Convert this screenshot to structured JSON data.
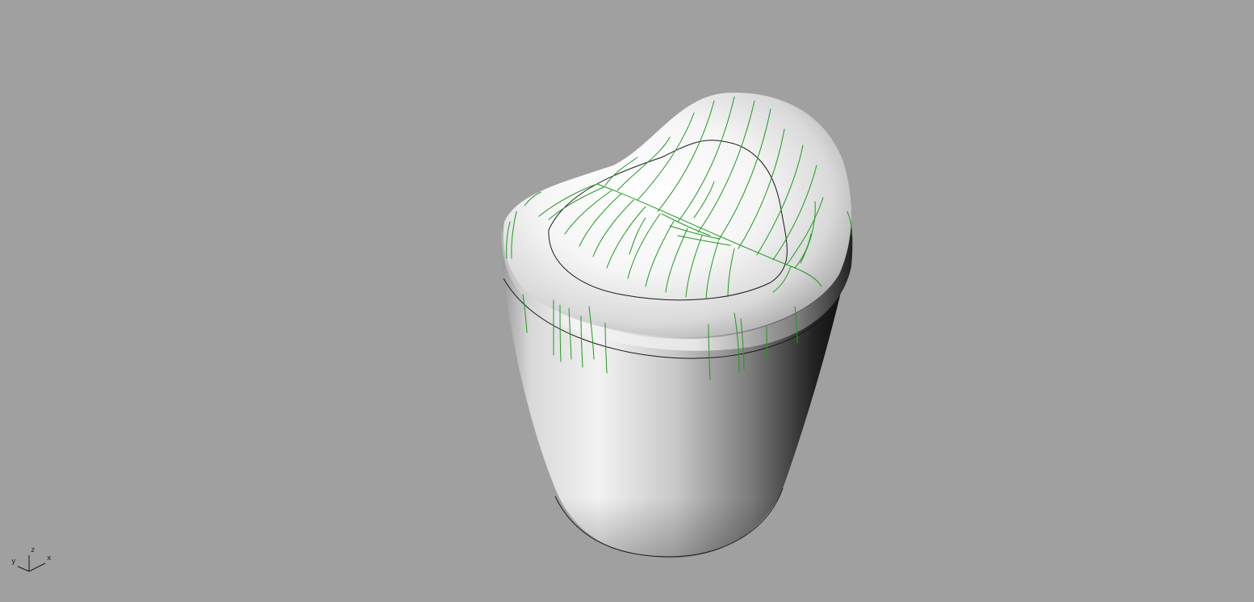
{
  "viewport": {
    "background_color": "#a0a0a0",
    "display_mode": "rendered-shaded",
    "model_color_light": "#ffffff",
    "model_color_dark": "#111111",
    "analysis_curve_color": "#1f9a1f",
    "edge_color": "#1a1a1a"
  },
  "axis_gizmo": {
    "y_label": "y",
    "z_label": "z",
    "x_label": "x",
    "icon": "world-axes-icon"
  }
}
